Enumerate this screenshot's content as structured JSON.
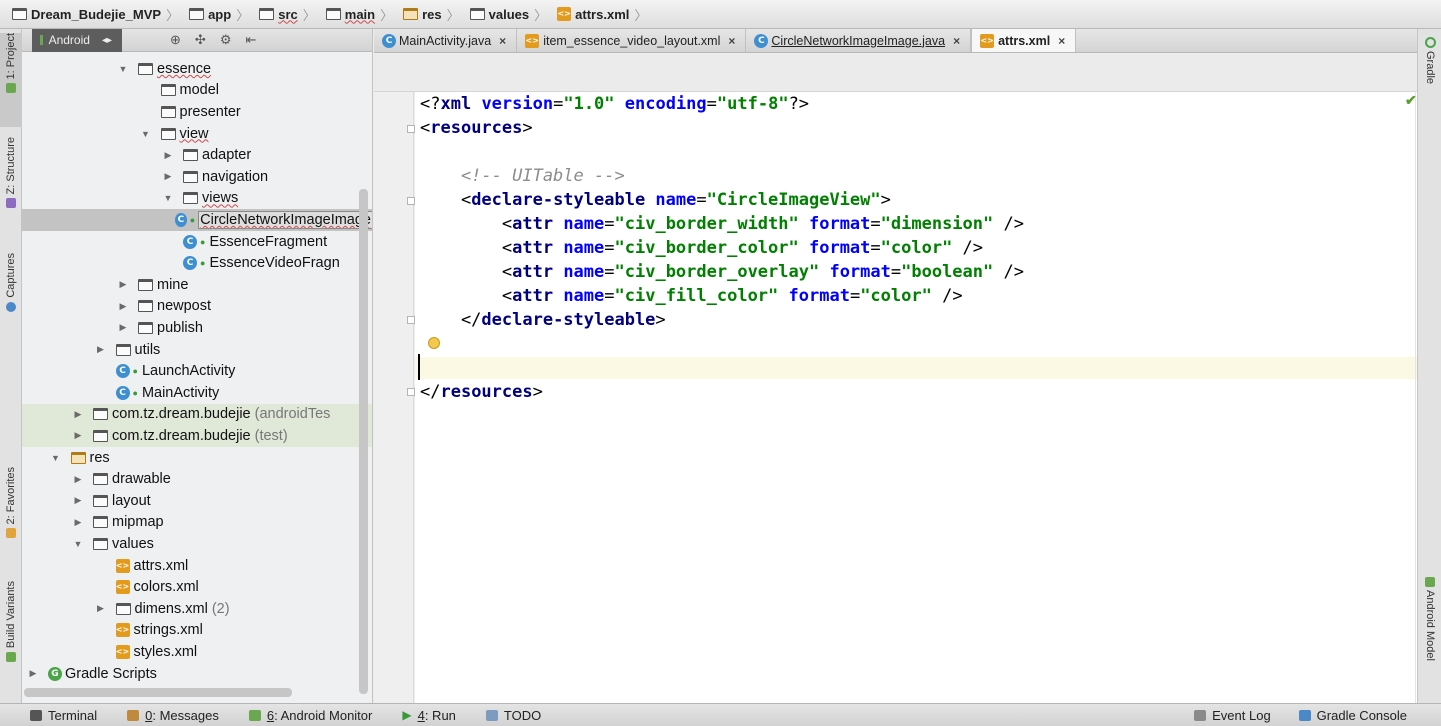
{
  "breadcrumbs": [
    "Dream_Budejie_MVP",
    "app",
    "src",
    "main",
    "res",
    "values",
    "attrs.xml"
  ],
  "project_panel": {
    "view_mode": "Android",
    "tree": [
      {
        "label": "essence",
        "type": "folder",
        "depth": 4,
        "arrow": "down",
        "wavy": true
      },
      {
        "label": "model",
        "type": "folder",
        "depth": 5,
        "arrow": ""
      },
      {
        "label": "presenter",
        "type": "folder",
        "depth": 5,
        "arrow": ""
      },
      {
        "label": "view",
        "type": "folder",
        "depth": 5,
        "arrow": "down",
        "wavy": true
      },
      {
        "label": "adapter",
        "type": "folder",
        "depth": 6,
        "arrow": "right"
      },
      {
        "label": "navigation",
        "type": "folder",
        "depth": 6,
        "arrow": "right"
      },
      {
        "label": "views",
        "type": "folder",
        "depth": 6,
        "arrow": "down",
        "wavy": true
      },
      {
        "label": "CircleNetworkImageImage",
        "type": "class",
        "depth": 7,
        "arrow": "",
        "selected": true,
        "wavy": true
      },
      {
        "label": "EssenceFragment",
        "type": "class",
        "depth": 6,
        "arrow": ""
      },
      {
        "label": "EssenceVideoFragn",
        "type": "class",
        "depth": 6,
        "arrow": ""
      },
      {
        "label": "mine",
        "type": "folder",
        "depth": 4,
        "arrow": "right"
      },
      {
        "label": "newpost",
        "type": "folder",
        "depth": 4,
        "arrow": "right"
      },
      {
        "label": "publish",
        "type": "folder",
        "depth": 4,
        "arrow": "right"
      },
      {
        "label": "utils",
        "type": "folder",
        "depth": 3,
        "arrow": "right"
      },
      {
        "label": "LaunchActivity",
        "type": "class",
        "depth": 3,
        "arrow": ""
      },
      {
        "label": "MainActivity",
        "type": "class",
        "depth": 3,
        "arrow": ""
      },
      {
        "label": "com.tz.dream.budejie",
        "suffix": "(androidTes",
        "type": "folder",
        "depth": 2,
        "arrow": "right",
        "green": true
      },
      {
        "label": "com.tz.dream.budejie",
        "suffix": "(test)",
        "type": "folder",
        "depth": 2,
        "arrow": "right",
        "green": true
      },
      {
        "label": "res",
        "type": "resfolder",
        "depth": 1,
        "arrow": "down"
      },
      {
        "label": "drawable",
        "type": "folder",
        "depth": 2,
        "arrow": "right"
      },
      {
        "label": "layout",
        "type": "folder",
        "depth": 2,
        "arrow": "right"
      },
      {
        "label": "mipmap",
        "type": "folder",
        "depth": 2,
        "arrow": "right"
      },
      {
        "label": "values",
        "type": "folder",
        "depth": 2,
        "arrow": "down"
      },
      {
        "label": "attrs.xml",
        "type": "xml",
        "depth": 3,
        "arrow": ""
      },
      {
        "label": "colors.xml",
        "type": "xml",
        "depth": 3,
        "arrow": ""
      },
      {
        "label": "dimens.xml",
        "suffix": "(2)",
        "type": "folder",
        "depth": 3,
        "arrow": "right"
      },
      {
        "label": "strings.xml",
        "type": "xml",
        "depth": 3,
        "arrow": ""
      },
      {
        "label": "styles.xml",
        "type": "xml",
        "depth": 3,
        "arrow": ""
      },
      {
        "label": "Gradle Scripts",
        "type": "gradle",
        "depth": 0,
        "arrow": "right"
      }
    ]
  },
  "left_tool_tabs": [
    "1: Project",
    "Z: Structure",
    "Captures",
    "2: Favorites",
    "Build Variants"
  ],
  "right_tool_tabs": [
    "Gradle",
    "Android Model"
  ],
  "editor_tabs": [
    {
      "label": "MainActivity.java",
      "icon": "class",
      "active": false
    },
    {
      "label": "item_essence_video_layout.xml",
      "icon": "xml",
      "active": false
    },
    {
      "label": "CircleNetworkImageImage.java",
      "icon": "class",
      "active": false,
      "underline": true
    },
    {
      "label": "attrs.xml",
      "icon": "xml",
      "active": true
    }
  ],
  "code_lines": [
    [
      {
        "t": "<?",
        "c": "pi"
      },
      {
        "t": "xml ",
        "c": "tg"
      },
      {
        "t": "version",
        "c": "an"
      },
      {
        "t": "=",
        "c": "pi"
      },
      {
        "t": "\"1.0\" ",
        "c": "av"
      },
      {
        "t": "encoding",
        "c": "an"
      },
      {
        "t": "=",
        "c": "pi"
      },
      {
        "t": "\"utf-8\"",
        "c": "av"
      },
      {
        "t": "?>",
        "c": "pi"
      }
    ],
    [
      {
        "t": "<",
        "c": "pi"
      },
      {
        "t": "resources",
        "c": "tg"
      },
      {
        "t": ">",
        "c": "pi"
      }
    ],
    [],
    [
      {
        "t": "    <!-- UITable -->",
        "c": "cm"
      }
    ],
    [
      {
        "t": "    <",
        "c": "pi"
      },
      {
        "t": "declare-styleable ",
        "c": "tg"
      },
      {
        "t": "name",
        "c": "an"
      },
      {
        "t": "=",
        "c": "pi"
      },
      {
        "t": "\"CircleImageView\"",
        "c": "av"
      },
      {
        "t": ">",
        "c": "pi"
      }
    ],
    [
      {
        "t": "        <",
        "c": "pi"
      },
      {
        "t": "attr ",
        "c": "tg"
      },
      {
        "t": "name",
        "c": "an"
      },
      {
        "t": "=",
        "c": "pi"
      },
      {
        "t": "\"civ_border_width\" ",
        "c": "av"
      },
      {
        "t": "format",
        "c": "an"
      },
      {
        "t": "=",
        "c": "pi"
      },
      {
        "t": "\"dimension\" ",
        "c": "av"
      },
      {
        "t": "/>",
        "c": "pi"
      }
    ],
    [
      {
        "t": "        <",
        "c": "pi"
      },
      {
        "t": "attr ",
        "c": "tg"
      },
      {
        "t": "name",
        "c": "an"
      },
      {
        "t": "=",
        "c": "pi"
      },
      {
        "t": "\"civ_border_color\" ",
        "c": "av"
      },
      {
        "t": "format",
        "c": "an"
      },
      {
        "t": "=",
        "c": "pi"
      },
      {
        "t": "\"color\" ",
        "c": "av"
      },
      {
        "t": "/>",
        "c": "pi"
      }
    ],
    [
      {
        "t": "        <",
        "c": "pi"
      },
      {
        "t": "attr ",
        "c": "tg"
      },
      {
        "t": "name",
        "c": "an"
      },
      {
        "t": "=",
        "c": "pi"
      },
      {
        "t": "\"civ_border_overlay\" ",
        "c": "av"
      },
      {
        "t": "format",
        "c": "an"
      },
      {
        "t": "=",
        "c": "pi"
      },
      {
        "t": "\"boolean\" ",
        "c": "av"
      },
      {
        "t": "/>",
        "c": "pi"
      }
    ],
    [
      {
        "t": "        <",
        "c": "pi"
      },
      {
        "t": "attr ",
        "c": "tg"
      },
      {
        "t": "name",
        "c": "an"
      },
      {
        "t": "=",
        "c": "pi"
      },
      {
        "t": "\"civ_fill_color\" ",
        "c": "av"
      },
      {
        "t": "format",
        "c": "an"
      },
      {
        "t": "=",
        "c": "pi"
      },
      {
        "t": "\"color\" ",
        "c": "av"
      },
      {
        "t": "/>",
        "c": "pi"
      }
    ],
    [
      {
        "t": "    </",
        "c": "pi"
      },
      {
        "t": "declare-styleable",
        "c": "tg"
      },
      {
        "t": ">",
        "c": "pi"
      }
    ],
    [],
    [],
    [
      {
        "t": "</",
        "c": "pi"
      },
      {
        "t": "resources",
        "c": "tg"
      },
      {
        "t": ">",
        "c": "pi"
      }
    ]
  ],
  "bottom_bar": {
    "left": [
      {
        "label": "Terminal",
        "mnemonic": "",
        "rest": "Terminal"
      },
      {
        "label": "0: Messages",
        "mnemonic": "0",
        "rest": ": Messages"
      },
      {
        "label": "6: Android Monitor",
        "mnemonic": "6",
        "rest": ": Android Monitor"
      },
      {
        "label": "4: Run",
        "mnemonic": "4",
        "rest": ": Run"
      },
      {
        "label": "TODO",
        "mnemonic": "",
        "rest": "TODO"
      }
    ],
    "right": [
      "Event Log",
      "Gradle Console"
    ]
  },
  "colors": {
    "tag": "#000080",
    "attr_name": "#0000ff",
    "attr_value": "#008000",
    "comment": "#8c8c8c",
    "current_line": "#fbf9e4",
    "selection": "#c3c3c3"
  }
}
